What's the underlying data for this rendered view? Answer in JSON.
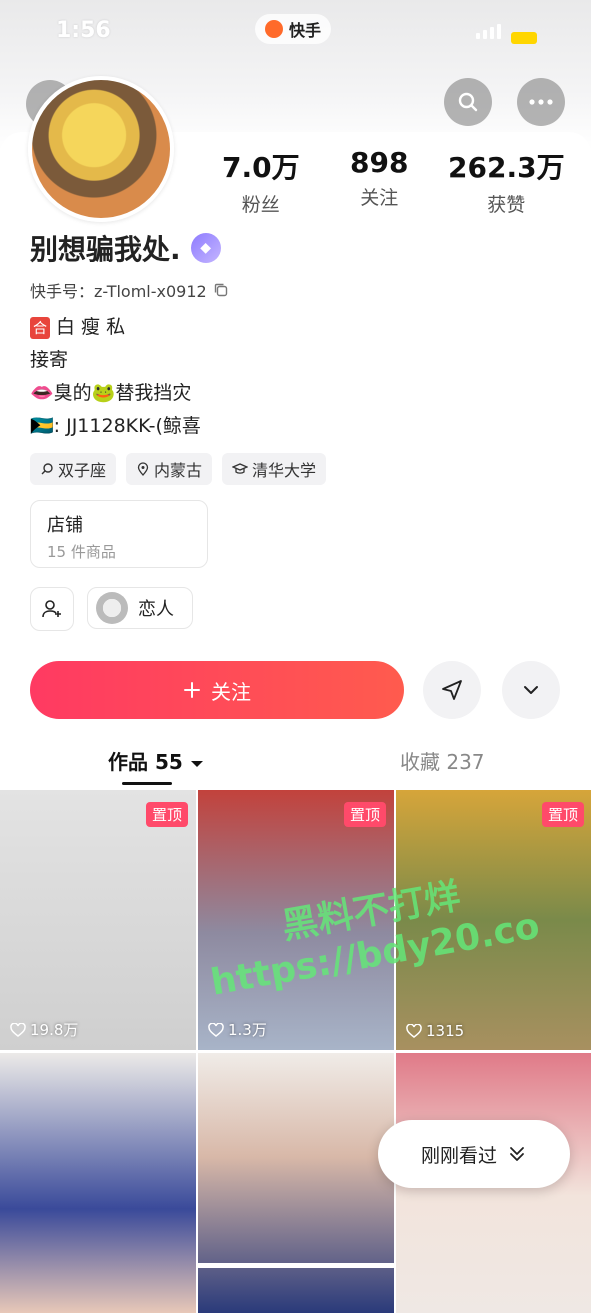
{
  "status": {
    "time": "1:56",
    "app_name": "快手"
  },
  "profile": {
    "name": "别想骗我处.",
    "uid_label": "快手号：z-Tloml-x0912",
    "stats": [
      {
        "value": "7.0万",
        "label": "粉丝"
      },
      {
        "value": "898",
        "label": "关注"
      },
      {
        "value": "262.3万",
        "label": "获赞"
      }
    ],
    "bio": [
      {
        "tag": "合",
        "text": "白 瘦 私"
      },
      {
        "text": "接寄"
      },
      {
        "text": "👄臭的🐸替我挡灾"
      },
      {
        "text": "🇧🇸: JJ1128KK-(鲸喜"
      }
    ],
    "tags": [
      "双子座",
      "内蒙古",
      "清华大学"
    ]
  },
  "shop": {
    "title": "店铺",
    "subtitle": "15 件商品"
  },
  "relation": {
    "label": "恋人"
  },
  "actions": {
    "follow_label": "关注"
  },
  "tabs": {
    "works": "作品 55",
    "favorites": "收藏 237"
  },
  "videos": [
    {
      "pinned": "置顶",
      "likes": "19.8万",
      "color": "#d9d9d9"
    },
    {
      "pinned": "置顶",
      "likes": "1.3万",
      "color": "#b54a44"
    },
    {
      "pinned": "置顶",
      "likes": "1315",
      "color": "#c79a3a"
    },
    {
      "pinned": "",
      "likes": "",
      "color": "#e8e6e4"
    },
    {
      "pinned": "",
      "likes": "",
      "color": "#d7c7c0"
    },
    {
      "pinned": "",
      "likes": "",
      "color": "#d97b86"
    }
  ],
  "watermark": {
    "line1": "黑料不打烊",
    "line2": "https://bdy20.co"
  },
  "recent": {
    "label": "刚刚看过"
  }
}
